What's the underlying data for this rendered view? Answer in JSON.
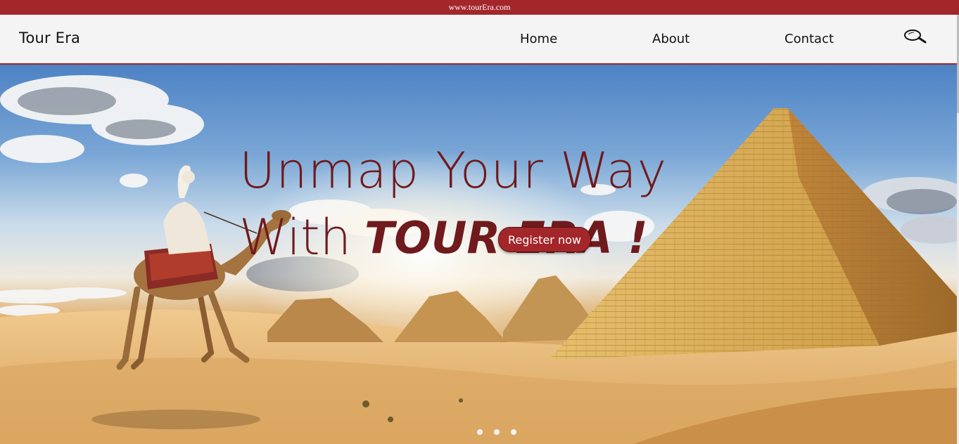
{
  "topbar": {
    "url_text": "www.tourEra.com"
  },
  "navbar": {
    "brand": "Tour Era",
    "links": [
      "Home",
      "About",
      "Contact"
    ],
    "search_icon": "magnifier-icon"
  },
  "hero": {
    "line1": "Unmap Your Way",
    "line2_prefix": "With",
    "line2_brand": "TOUR ERA !",
    "cta": "Register now",
    "slides": {
      "count": 3
    }
  },
  "colors": {
    "accent": "#a3262a",
    "headline": "#6f1a1c",
    "nav_bg": "#f4f4f4"
  }
}
